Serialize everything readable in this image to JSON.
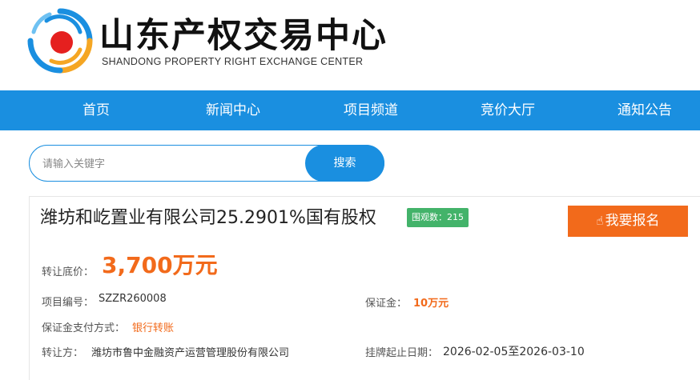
{
  "brand": {
    "name_cn": "山东产权交易中心",
    "name_en": "SHANDONG PROPERTY RIGHT EXCHANGE CENTER"
  },
  "nav": {
    "items": [
      "首页",
      "新闻中心",
      "项目频道",
      "竞价大厅",
      "通知公告"
    ]
  },
  "search": {
    "placeholder": "请输入关键字",
    "button": "搜索"
  },
  "project": {
    "title": "潍坊和屹置业有限公司25.2901%国有股权",
    "views_label": "围观数：215",
    "signup_button": "我要报名",
    "price_label": "转让底价：",
    "price_value": "3,700万元",
    "code_label": "项目编号：",
    "code_value": "SZZR260008",
    "deposit_label": "保证金：",
    "deposit_value": "10万元",
    "pay_label": "保证金支付方式：",
    "pay_value": "银行转账",
    "seller_label": "转让方：",
    "seller_value": "潍坊市鲁中金融资产运营管理股份有限公司",
    "date_label": "挂牌起止日期：",
    "date_value": "2026-02-05至2026-03-10"
  },
  "colors": {
    "primary": "#1a8fe0",
    "accent": "#f26a1b",
    "badge": "#43b36a"
  }
}
